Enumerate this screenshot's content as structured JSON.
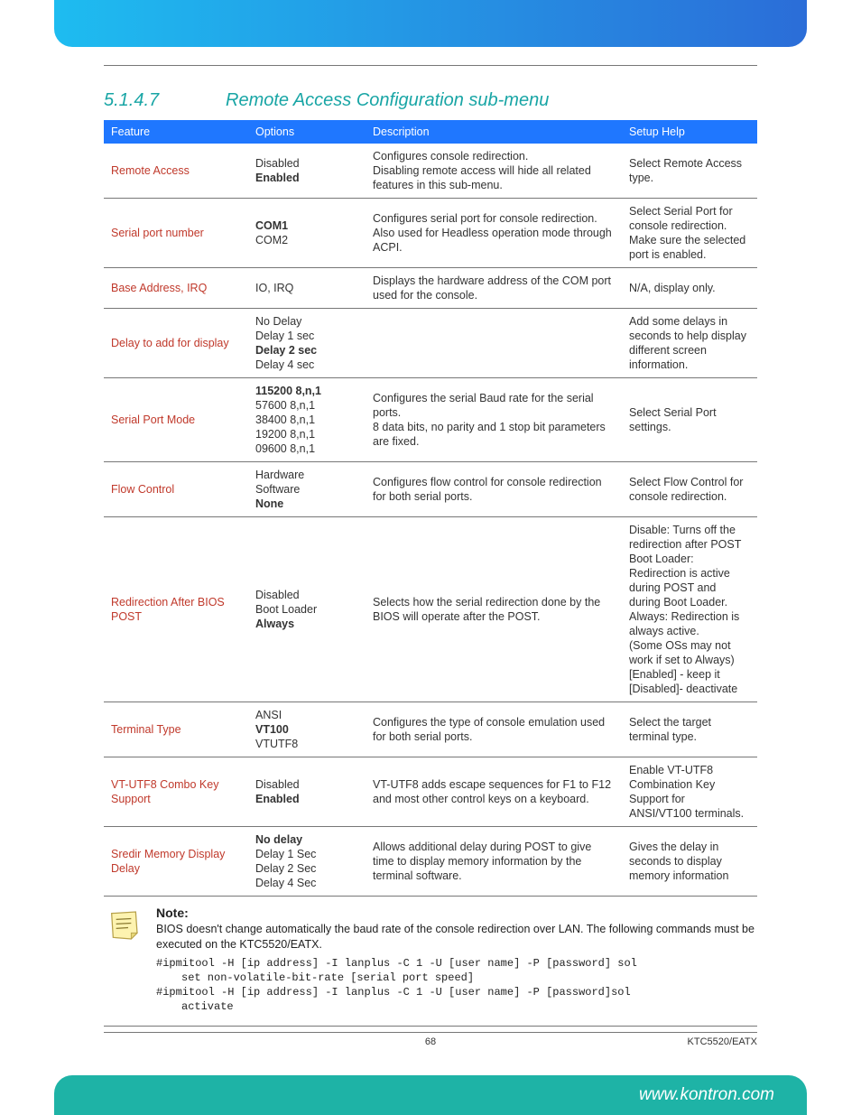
{
  "section": {
    "number": "5.1.4.7",
    "title": "Remote Access Configuration sub-menu"
  },
  "table": {
    "headers": {
      "feature": "Feature",
      "options": "Options",
      "description": "Description",
      "help": "Setup Help"
    },
    "rows": [
      {
        "feature": "Remote Access",
        "opts": [
          "Disabled",
          "Enabled"
        ],
        "bold": [
          1
        ],
        "desc": "Configures console redirection.\nDisabling remote access will hide all related features in this sub-menu.",
        "help": "Select Remote Access type."
      },
      {
        "feature": "Serial port number",
        "opts": [
          "COM1",
          "COM2"
        ],
        "bold": [
          0
        ],
        "desc": "Configures serial port for console redirection. Also used for Headless operation mode through ACPI.",
        "help": "Select Serial Port for console redirection. Make sure the selected port is enabled."
      },
      {
        "feature": "Base Address, IRQ",
        "opts": [
          "IO, IRQ"
        ],
        "bold": [],
        "desc": "Displays the hardware address of the COM port used for the console.",
        "help": "N/A, display only."
      },
      {
        "feature": "Delay to add for display",
        "opts": [
          "No Delay",
          "Delay 1 sec",
          "Delay 2 sec",
          "Delay 4 sec"
        ],
        "bold": [
          2
        ],
        "desc": "",
        "help": "Add some delays in seconds to help display different screen information."
      },
      {
        "feature": "Serial Port Mode",
        "opts": [
          "115200 8,n,1",
          "57600 8,n,1",
          "38400 8,n,1",
          "19200 8,n,1",
          "09600 8,n,1"
        ],
        "bold": [
          0
        ],
        "desc": "Configures the serial Baud rate for the serial ports.\n8 data bits, no parity and 1 stop bit parameters are fixed.",
        "help": "Select Serial Port settings."
      },
      {
        "feature": "Flow Control",
        "opts": [
          "Hardware",
          "Software",
          "None"
        ],
        "bold": [
          2
        ],
        "desc": "Configures flow control for console redirection for both serial ports.",
        "help": "Select Flow Control for console redirection."
      },
      {
        "feature": "Redirection After BIOS POST",
        "opts": [
          "Disabled",
          "Boot Loader",
          "Always"
        ],
        "bold": [
          2
        ],
        "desc": "Selects how the serial redirection done by the BIOS will operate after the POST.",
        "help": "Disable: Turns off the redirection after POST\nBoot Loader: Redirection is active during POST and during Boot Loader.\nAlways: Redirection is always active.\n(Some OSs may not work if set to Always)\n[Enabled] - keep it\n[Disabled]- deactivate"
      },
      {
        "feature": "Terminal Type",
        "opts": [
          "ANSI",
          "VT100",
          "VTUTF8"
        ],
        "bold": [
          1
        ],
        "desc": "Configures the type of console emulation used for both serial ports.",
        "help": "Select the target terminal type."
      },
      {
        "feature": "VT-UTF8 Combo Key Support",
        "opts": [
          "Disabled",
          "Enabled"
        ],
        "bold": [
          1
        ],
        "desc": "VT-UTF8 adds escape sequences for F1 to F12 and most other control keys on a keyboard.",
        "help": "Enable VT-UTF8 Combination Key Support for ANSI/VT100 terminals."
      },
      {
        "feature": "Sredir Memory Display Delay",
        "opts": [
          "No delay",
          "Delay 1 Sec",
          "Delay 2 Sec",
          "Delay 4 Sec"
        ],
        "bold": [
          0
        ],
        "desc": "Allows additional delay during POST to give time to display memory information by the terminal software.",
        "help": "Gives the delay in seconds to display memory information"
      }
    ]
  },
  "note": {
    "title": "Note:",
    "text": "BIOS doesn't change automatically the baud rate of the console redirection over LAN. The following commands must be executed on the KTC5520/EATX.",
    "code1a": "#ipmitool -H [ip address] -I lanplus -C 1 -U [user name] -P [password] sol",
    "code1b": "set non-volatile-bit-rate [serial port speed]",
    "code2a": "#ipmitool -H [ip address] -I lanplus -C 1 -U [user name] -P [password]sol",
    "code2b": "activate"
  },
  "footer": {
    "page": "68",
    "doc": "KTC5520/EATX",
    "url": "www.kontron.com"
  }
}
